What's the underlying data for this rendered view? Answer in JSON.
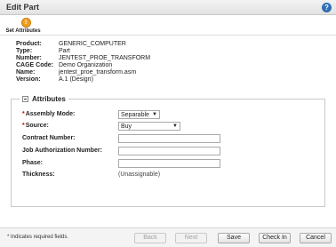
{
  "window": {
    "title": "Edit Part"
  },
  "step": {
    "label": "Set Attributes",
    "icon": "step-flag-icon"
  },
  "info": [
    {
      "key": "Product:",
      "value": "GENERIC_COMPUTER"
    },
    {
      "key": "Type:",
      "value": "Part"
    },
    {
      "key": "Number:",
      "value": "JENTEST_PROE_TRANSFORM"
    },
    {
      "key": "CAGE Code:",
      "value": "Demo Organization"
    },
    {
      "key": "Name:",
      "value": "jentest_proe_transform.asm"
    },
    {
      "key": "Version:",
      "value": "A.1 (Design)"
    }
  ],
  "attributes": {
    "legend": "Attributes",
    "assembly_mode": {
      "label": "Assembly Mode:",
      "value": "Separable"
    },
    "source": {
      "label": "Source:",
      "value": "Buy"
    },
    "contract_number": {
      "label": "Contract Number:",
      "value": ""
    },
    "job_auth_number": {
      "label": "Job Authorization Number:",
      "value": ""
    },
    "phase": {
      "label": "Phase:",
      "value": ""
    },
    "thickness": {
      "label": "Thickness:",
      "value": "(Unassignable)"
    }
  },
  "footer": {
    "required_note": "* Indicates required fields.",
    "back": "Back",
    "next": "Next",
    "save": "Save",
    "check_in": "Check In",
    "cancel": "Cancel"
  },
  "colors": {
    "help_icon": "#2f6db5",
    "step_icon": "#f0a020",
    "required": "#cc0000"
  }
}
